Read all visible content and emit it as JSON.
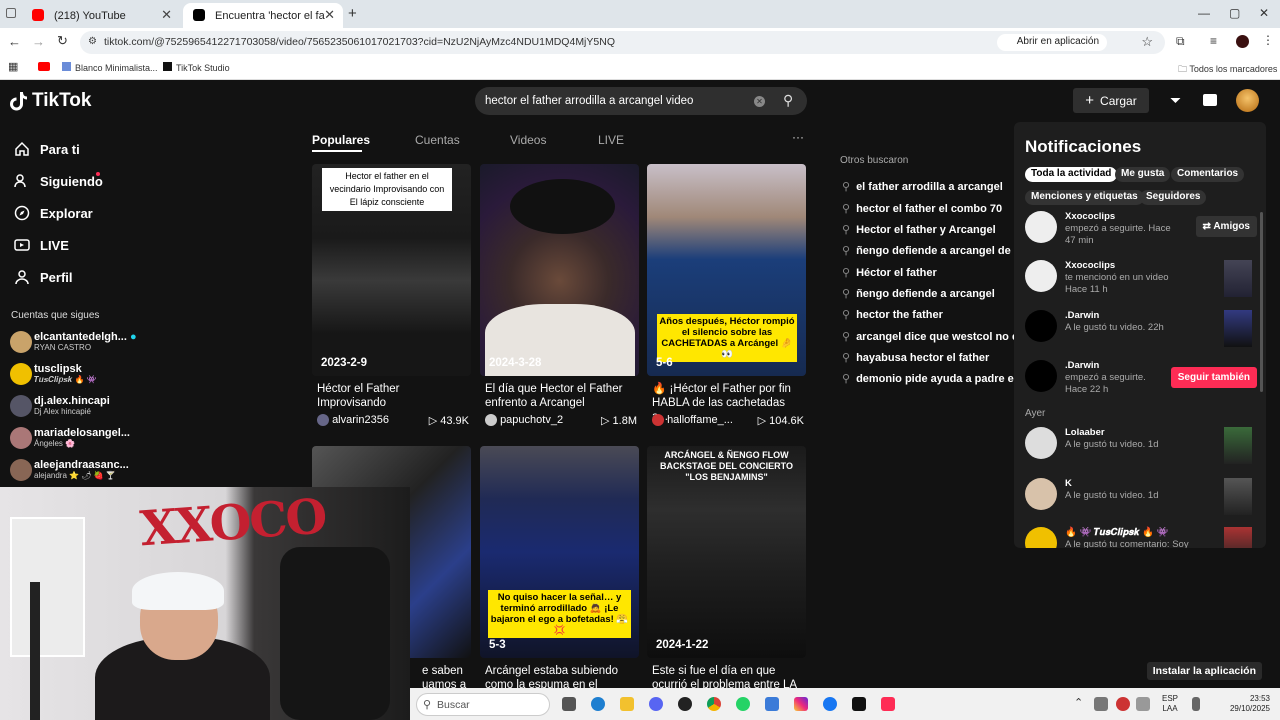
{
  "browser": {
    "tabs": [
      {
        "title": "(218) YouTube",
        "color": "#ff0000"
      },
      {
        "title": "Encuentra 'hector el father arro",
        "color": "#000000"
      }
    ],
    "url": "tiktok.com/@7525965412271703058/video/7565235061017021703?cid=NzU2NjAyMzc4NDU1MDQ4MjY5NQ",
    "open_app": "Abrir en aplicación",
    "bookmarks": [
      "Blanco Minimalista...",
      "TikTok Studio"
    ],
    "all_bookmarks": "Todos los marcadores"
  },
  "tiktok": {
    "logo": "TikTok",
    "search_query": "hector el father arrodilla a arcangel video",
    "upload": "Cargar",
    "nav": [
      "Para ti",
      "Siguiendo",
      "Explorar",
      "LIVE",
      "Perfil"
    ],
    "follows_title": "Cuentas que sigues",
    "follows": [
      {
        "name": "elcantantedelgh...",
        "sub": "RYAN CASTRO",
        "color": "#c9a36a"
      },
      {
        "name": "tusclipsk",
        "sub": "𝑻𝒖𝒔𝑪𝒍𝒊𝒑𝒔𝒌 🔥 👾",
        "color": "#f0c000"
      },
      {
        "name": "dj.alex.hincapi",
        "sub": "Dj Alex hincapié",
        "color": "#556"
      },
      {
        "name": "mariadelosangel...",
        "sub": "Ángeles 🌸",
        "color": "#a77"
      },
      {
        "name": "aleejandraasanc...",
        "sub": "alejandra ⭐ 🌶 🍓 🍸",
        "color": "#865"
      }
    ],
    "search_tabs": [
      "Populares",
      "Cuentas",
      "Videos",
      "LIVE"
    ],
    "more": "···",
    "videos": [
      {
        "date": "2023-2-9",
        "title": "Héctor el Father Improvisando",
        "author": "alvarin2356",
        "plays": "43.9K",
        "overlay": "Hector el father en el vecindario Improvisando con El lápiz consciente"
      },
      {
        "date": "2024-3-28",
        "title": "El día que Hector el Father enfrento a Arcangel",
        "author": "papuchotv_2",
        "plays": "1.8M"
      },
      {
        "date": "5-6",
        "title": "🔥 ¡Héctor el Father por fin HABLA de las cachetadas a...",
        "author": "halloffame_...",
        "plays": "104.6K",
        "overlay": "Años después, Héctor rompió el silencio sobre las CACHETADAS a Arcángel 🤌👀"
      },
      {
        "date": "",
        "title": "e saben uamos a",
        "author": "",
        "plays": ""
      },
      {
        "date": "5-3",
        "title": "Arcángel estaba subiendo como la espuma en el",
        "author": "",
        "plays": "",
        "overlay": "No quiso hacer la señal… y terminó arrodillado 🙇 ¡Le bajaron el ego a bofetadas! 😤💢"
      },
      {
        "date": "2024-1-22",
        "title": "Este si fue el día en que ocurrió el problema entre LA",
        "author": "",
        "plays": "",
        "overlay": "ARCÁNGEL & ÑENGO FLOW BACKSTAGE DEL CONCIERTO \"LOS BENJAMINS\""
      }
    ],
    "others_title": "Otros buscaron",
    "others": [
      "el father arrodilla a arcangel",
      "hector el father el combo 70",
      "Hector el father y Arcangel",
      "ñengo defiende a arcangel de la",
      "Héctor el father",
      "ñengo defiende a arcangel",
      "hector the father",
      "arcangel dice que westcol no es",
      "hayabusa hector el father",
      "demonio pide ayuda a padre en"
    ],
    "notifications": {
      "title": "Notificaciones",
      "filters": [
        "Toda la actividad",
        "Me gusta",
        "Comentarios",
        "Menciones y etiquetas",
        "Seguidores"
      ],
      "items": [
        {
          "name": "Xxococlips",
          "text": "empezó a seguirte. Hace 47 min",
          "button": "Amigos"
        },
        {
          "name": "Xxococlips",
          "text": "te mencionó en un video Hace 11 h"
        },
        {
          "name": ".Darwin",
          "text": "A le gustó tu video. 22h"
        },
        {
          "name": ".Darwin",
          "text": "empezó a seguirte. Hace 22 h",
          "button": "Seguir también"
        },
        {
          "name": "Lolaaber",
          "text": "A le gustó tu video. 1d"
        },
        {
          "name": "K",
          "text": "A le gustó tu video. 1d"
        },
        {
          "name": "🔥 👾 𝑻𝒖𝒔𝑪𝒍𝒊𝒑𝒔𝒌 🔥 👾",
          "text": "A le gustó tu comentario: Soy"
        }
      ],
      "yesterday": "Ayer"
    },
    "install": "Instalar la aplicación"
  },
  "taskbar": {
    "search": "Buscar",
    "lang": [
      "ESP",
      "LAA"
    ],
    "time": "23:53",
    "date": "29/10/2025"
  },
  "webcam_sign": "XXOCO"
}
